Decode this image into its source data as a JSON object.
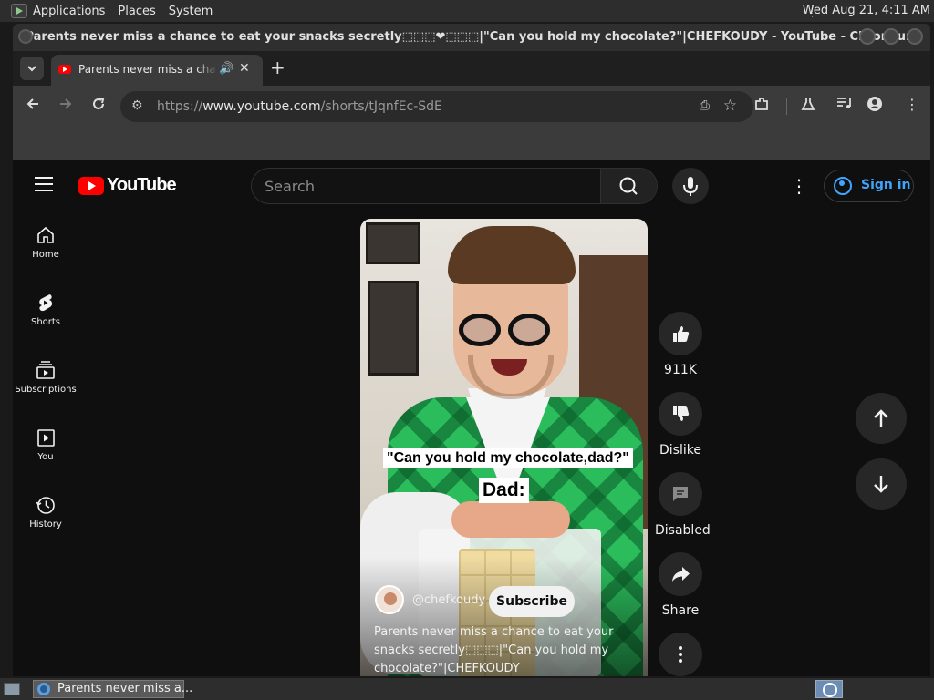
{
  "system_panel": {
    "menus": [
      "Applications",
      "Places",
      "System"
    ],
    "clock": "Wed Aug 21,  4:11 AM"
  },
  "window": {
    "title": "Parents never miss a chance to eat your snacks secretly⬚⬚⬚❤⬚⬚⬚|\"Can you hold my chocolate?\"|CHEFKOUDY - YouTube - Chromium"
  },
  "browser": {
    "tab_title": "Parents never miss a chance to eat your snacks secretly",
    "url_scheme": "https://",
    "url_host": "www.youtube.com",
    "url_path": "/shorts/tJqnfEc-SdE"
  },
  "youtube": {
    "logo_text": "YouTube",
    "search_placeholder": "Search",
    "sign_in_label": "Sign in",
    "guide": [
      {
        "label": "Home",
        "icon": "home-icon"
      },
      {
        "label": "Shorts",
        "icon": "shorts-icon"
      },
      {
        "label": "Subscriptions",
        "icon": "subscriptions-icon"
      },
      {
        "label": "You",
        "icon": "you-icon"
      },
      {
        "label": "History",
        "icon": "history-icon"
      }
    ],
    "short": {
      "caption_line1": "\"Can you hold my chocolate,dad?\"",
      "caption_line2": "Dad:",
      "channel": "@chefkoudy",
      "subscribe_label": "Subscribe",
      "description": "Parents never miss a chance to eat your snacks secretly⬚⬚⬚|\"Can you hold my chocolate?\"|CHEFKOUDY"
    },
    "actions": {
      "like_count": "911K",
      "dislike_label": "Dislike",
      "comments_label": "Disabled",
      "share_label": "Share"
    }
  },
  "taskbar": {
    "task_label": "Parents never miss a..."
  },
  "colors": {
    "youtube_red": "#ff0000",
    "link_blue": "#3ea6ff",
    "page_bg": "#0f0f0f",
    "sweater_green": "#2bbd5c"
  }
}
